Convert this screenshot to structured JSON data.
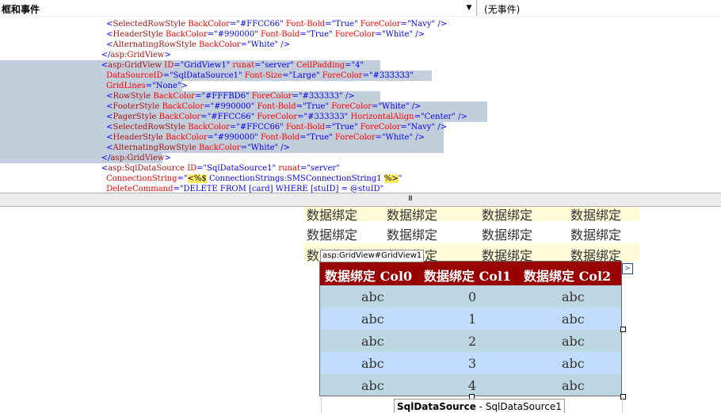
{
  "toolbar": {
    "object_combo": "框和事件",
    "event_combo": "(无事件)",
    "dropdown_glyph": "▼"
  },
  "code_lines": [
    [
      [
        "s",
        "      "
      ],
      [
        "p",
        "<"
      ],
      [
        "t",
        "SelectedRowStyle"
      ],
      [
        "s",
        " "
      ],
      [
        "a",
        "BackColor"
      ],
      [
        "p",
        "="
      ],
      [
        "v",
        "\"#FFCC66\""
      ],
      [
        "s",
        " "
      ],
      [
        "a",
        "Font-Bold"
      ],
      [
        "p",
        "="
      ],
      [
        "v",
        "\"True\""
      ],
      [
        "s",
        " "
      ],
      [
        "a",
        "ForeColor"
      ],
      [
        "p",
        "="
      ],
      [
        "v",
        "\"Navy\""
      ],
      [
        "s",
        " "
      ],
      [
        "p",
        "/>"
      ]
    ],
    [
      [
        "s",
        "      "
      ],
      [
        "p",
        "<"
      ],
      [
        "t",
        "HeaderStyle"
      ],
      [
        "s",
        " "
      ],
      [
        "a",
        "BackColor"
      ],
      [
        "p",
        "="
      ],
      [
        "v",
        "\"#990000\""
      ],
      [
        "s",
        " "
      ],
      [
        "a",
        "Font-Bold"
      ],
      [
        "p",
        "="
      ],
      [
        "v",
        "\"True\""
      ],
      [
        "s",
        " "
      ],
      [
        "a",
        "ForeColor"
      ],
      [
        "p",
        "="
      ],
      [
        "v",
        "\"White\""
      ],
      [
        "s",
        " "
      ],
      [
        "p",
        "/>"
      ]
    ],
    [
      [
        "s",
        "      "
      ],
      [
        "p",
        "<"
      ],
      [
        "t",
        "AlternatingRowStyle"
      ],
      [
        "s",
        " "
      ],
      [
        "a",
        "BackColor"
      ],
      [
        "p",
        "="
      ],
      [
        "v",
        "\"White\""
      ],
      [
        "s",
        " "
      ],
      [
        "p",
        "/>"
      ]
    ],
    [
      [
        "s",
        "    "
      ],
      [
        "p",
        "</"
      ],
      [
        "t",
        "asp:GridView"
      ],
      [
        "p",
        ">"
      ]
    ],
    [
      [
        "s",
        "    "
      ],
      [
        "p",
        "<"
      ],
      [
        "t",
        "asp:GridView"
      ],
      [
        "s",
        " "
      ],
      [
        "a",
        "ID"
      ],
      [
        "p",
        "="
      ],
      [
        "v",
        "\"GridView1\""
      ],
      [
        "s",
        " "
      ],
      [
        "a",
        "runat"
      ],
      [
        "p",
        "="
      ],
      [
        "v",
        "\"server\""
      ],
      [
        "s",
        " "
      ],
      [
        "a",
        "CellPadding"
      ],
      [
        "p",
        "="
      ],
      [
        "v",
        "\"4\""
      ]
    ],
    [
      [
        "s",
        "      "
      ],
      [
        "a",
        "DataSourceID"
      ],
      [
        "p",
        "="
      ],
      [
        "v",
        "\"SqlDataSource1\""
      ],
      [
        "s",
        " "
      ],
      [
        "a",
        "Font-Size"
      ],
      [
        "p",
        "="
      ],
      [
        "v",
        "\"Large\""
      ],
      [
        "s",
        " "
      ],
      [
        "a",
        "ForeColor"
      ],
      [
        "p",
        "="
      ],
      [
        "v",
        "\"#333333\""
      ]
    ],
    [
      [
        "s",
        "      "
      ],
      [
        "a",
        "GridLines"
      ],
      [
        "p",
        "="
      ],
      [
        "v",
        "\"None\""
      ],
      [
        "p",
        ">"
      ]
    ],
    [
      [
        "s",
        "      "
      ],
      [
        "p",
        "<"
      ],
      [
        "t",
        "RowStyle"
      ],
      [
        "s",
        " "
      ],
      [
        "a",
        "BackColor"
      ],
      [
        "p",
        "="
      ],
      [
        "v",
        "\"#FFFBD6\""
      ],
      [
        "s",
        " "
      ],
      [
        "a",
        "ForeColor"
      ],
      [
        "p",
        "="
      ],
      [
        "v",
        "\"#333333\""
      ],
      [
        "s",
        " "
      ],
      [
        "p",
        "/>"
      ]
    ],
    [
      [
        "s",
        "      "
      ],
      [
        "p",
        "<"
      ],
      [
        "t",
        "FooterStyle"
      ],
      [
        "s",
        " "
      ],
      [
        "a",
        "BackColor"
      ],
      [
        "p",
        "="
      ],
      [
        "v",
        "\"#990000\""
      ],
      [
        "s",
        " "
      ],
      [
        "a",
        "Font-Bold"
      ],
      [
        "p",
        "="
      ],
      [
        "v",
        "\"True\""
      ],
      [
        "s",
        " "
      ],
      [
        "a",
        "ForeColor"
      ],
      [
        "p",
        "="
      ],
      [
        "v",
        "\"White\""
      ],
      [
        "s",
        " "
      ],
      [
        "p",
        "/>"
      ]
    ],
    [
      [
        "s",
        "      "
      ],
      [
        "p",
        "<"
      ],
      [
        "t",
        "PagerStyle"
      ],
      [
        "s",
        " "
      ],
      [
        "a",
        "BackColor"
      ],
      [
        "p",
        "="
      ],
      [
        "v",
        "\"#FFCC66\""
      ],
      [
        "s",
        " "
      ],
      [
        "a",
        "ForeColor"
      ],
      [
        "p",
        "="
      ],
      [
        "v",
        "\"#333333\""
      ],
      [
        "s",
        " "
      ],
      [
        "a",
        "HorizontalAlign"
      ],
      [
        "p",
        "="
      ],
      [
        "v",
        "\"Center\""
      ],
      [
        "s",
        " "
      ],
      [
        "p",
        "/>"
      ]
    ],
    [
      [
        "s",
        "      "
      ],
      [
        "p",
        "<"
      ],
      [
        "t",
        "SelectedRowStyle"
      ],
      [
        "s",
        " "
      ],
      [
        "a",
        "BackColor"
      ],
      [
        "p",
        "="
      ],
      [
        "v",
        "\"#FFCC66\""
      ],
      [
        "s",
        " "
      ],
      [
        "a",
        "Font-Bold"
      ],
      [
        "p",
        "="
      ],
      [
        "v",
        "\"True\""
      ],
      [
        "s",
        " "
      ],
      [
        "a",
        "ForeColor"
      ],
      [
        "p",
        "="
      ],
      [
        "v",
        "\"Navy\""
      ],
      [
        "s",
        " "
      ],
      [
        "p",
        "/>"
      ]
    ],
    [
      [
        "s",
        "      "
      ],
      [
        "p",
        "<"
      ],
      [
        "t",
        "HeaderStyle"
      ],
      [
        "s",
        " "
      ],
      [
        "a",
        "BackColor"
      ],
      [
        "p",
        "="
      ],
      [
        "v",
        "\"#990000\""
      ],
      [
        "s",
        " "
      ],
      [
        "a",
        "Font-Bold"
      ],
      [
        "p",
        "="
      ],
      [
        "v",
        "\"True\""
      ],
      [
        "s",
        " "
      ],
      [
        "a",
        "ForeColor"
      ],
      [
        "p",
        "="
      ],
      [
        "v",
        "\"White\""
      ],
      [
        "s",
        " "
      ],
      [
        "p",
        "/>"
      ]
    ],
    [
      [
        "s",
        "      "
      ],
      [
        "p",
        "<"
      ],
      [
        "t",
        "AlternatingRowStyle"
      ],
      [
        "s",
        " "
      ],
      [
        "a",
        "BackColor"
      ],
      [
        "p",
        "="
      ],
      [
        "v",
        "\"White\""
      ],
      [
        "s",
        " "
      ],
      [
        "p",
        "/>"
      ]
    ],
    [
      [
        "s",
        "    "
      ],
      [
        "p",
        "</"
      ],
      [
        "t",
        "asp:GridView"
      ],
      [
        "p",
        ">"
      ]
    ],
    [
      [
        "s",
        "    "
      ],
      [
        "p",
        "<"
      ],
      [
        "t",
        "asp:SqlDataSource"
      ],
      [
        "s",
        " "
      ],
      [
        "a",
        "ID"
      ],
      [
        "p",
        "="
      ],
      [
        "v",
        "\"SqlDataSource1\""
      ],
      [
        "s",
        " "
      ],
      [
        "a",
        "runat"
      ],
      [
        "p",
        "="
      ],
      [
        "v",
        "\"server\""
      ]
    ],
    [
      [
        "s",
        "      "
      ],
      [
        "a",
        "ConnectionString"
      ],
      [
        "p",
        "="
      ],
      [
        "v",
        "\""
      ],
      [
        "h",
        "<%$"
      ],
      [
        "s",
        " ConnectionStrings:SMSConnectionString1 "
      ],
      [
        "h",
        "%>"
      ],
      [
        "v",
        "\""
      ]
    ],
    [
      [
        "s",
        "      "
      ],
      [
        "a",
        "DeleteCommand"
      ],
      [
        "p",
        "="
      ],
      [
        "v",
        "\"DELETE FROM [card] WHERE [stuID] = @stuID\""
      ]
    ]
  ],
  "splitter_grip": "III",
  "ghost_rows": [
    [
      "数据绑定",
      "数据绑定",
      "数据绑定",
      "数据绑定"
    ],
    [
      "数据绑定",
      "数据绑定",
      "数据绑定",
      "数据绑定"
    ],
    [
      "数据绑定",
      "数据绑定",
      "数据绑定",
      "数据绑定"
    ]
  ],
  "gridview_tag": "asp:GridView#GridView1",
  "smart_tag_glyph": ">",
  "grid": {
    "columns": [
      "数据绑定 Col0",
      "数据绑定 Col1",
      "数据绑定 Col2"
    ],
    "rows": [
      [
        "abc",
        "0",
        "abc"
      ],
      [
        "abc",
        "1",
        "abc"
      ],
      [
        "abc",
        "2",
        "abc"
      ],
      [
        "abc",
        "3",
        "abc"
      ],
      [
        "abc",
        "4",
        "abc"
      ]
    ]
  },
  "sqldatasource": {
    "type_label": "SqlDataSource",
    "separator": " - ",
    "id_label": "SqlDataSource1"
  },
  "colors": {
    "header_bg": "#990000",
    "row_a": "#bcd6e2",
    "row_b": "#c0dcfb",
    "ghost_alt": "#fffbd6",
    "selection": "#c3cedc"
  }
}
